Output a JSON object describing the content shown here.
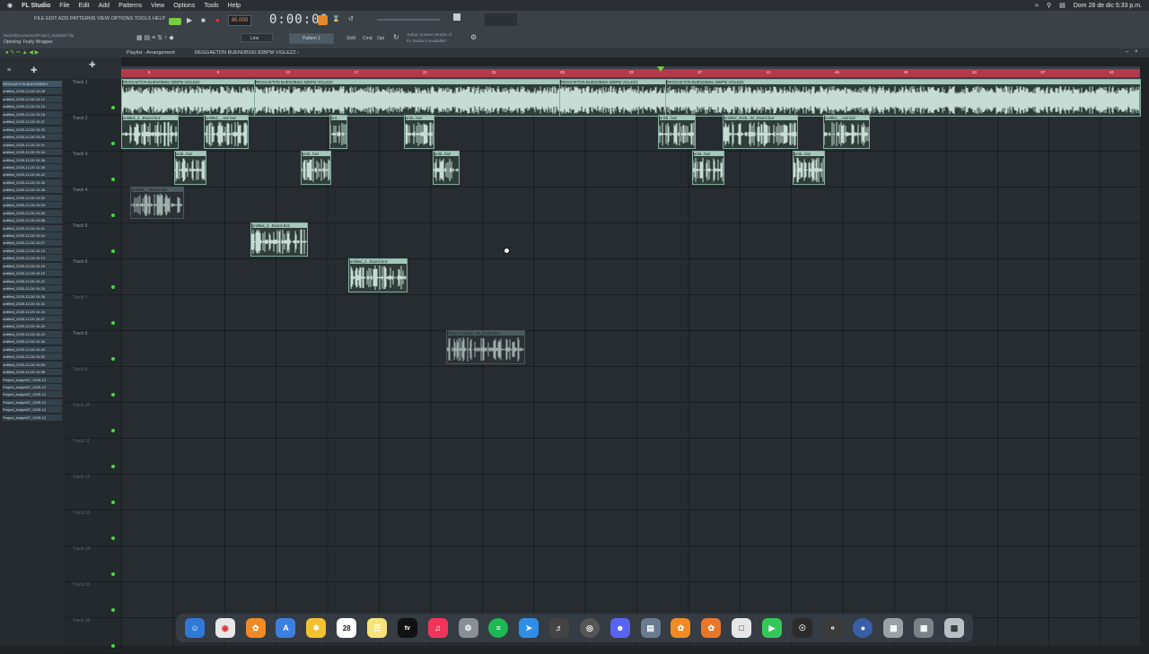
{
  "menubar": {
    "app": "FL Studio",
    "items": [
      "File",
      "Edit",
      "Add",
      "Patterns",
      "View",
      "Options",
      "Tools",
      "Help"
    ],
    "clock": "Dom 28 de dic 5:33 p.m."
  },
  "toolbar": {
    "menu_text": "FILE EDIT ADD PATTERNS VIEW OPTIONS TOOLS HELP",
    "tempo": "85.000",
    "time": "0:00:00",
    "project_path": "Music/Documents/Project_bulaph07.flp",
    "status": "Opening: Fruity Wrapper",
    "snap": "Line",
    "pattern": "Pattern 1",
    "mode_shift": "Shift",
    "mode_cmd": "Cmd",
    "mode_opt": "Opt",
    "news_line1": "Today: Answer version of",
    "news_line2": "FL Studio is available!"
  },
  "playlist": {
    "title": "Playlist - Arrangement",
    "breadcrumb": "REGGAETON BUENOBSKI 82BPM VIGLEZ2 ›",
    "ruler_ticks": [
      "5",
      "9",
      "13",
      "17",
      "21",
      "25",
      "29",
      "33",
      "37",
      "41",
      "45",
      "49",
      "53",
      "57",
      "61"
    ]
  },
  "browser": {
    "items": [
      "REGGAETON BUENOBSKI",
      "untitled_2025-12-26 15-08",
      "untitled_2025-12-26 15-12",
      "untitled_2025-12-26 15-15",
      "untitled_2025-12-26 15-18",
      "untitled_2025-12-26 15-21",
      "untitled_2025-12-26 15-25",
      "untitled_2025-12-26 15-28",
      "untitled_2025-12-26 15-31",
      "untitled_2025-12-26 15-34",
      "untitled_2025-12-26 15-36",
      "untitled_2025-12-26 15-39",
      "untitled_2025-12-26 15-42",
      "untitled_2025-12-26 15-45",
      "untitled_2025-12-26 15-48",
      "untitled_2025-12-26 15-50",
      "untitled_2025-12-26 15-53",
      "untitled_2025-12-26 15-55",
      "untitled_2025-12-26 15-58",
      "untitled_2025-12-26 16-01",
      "untitled_2025-12-26 16-04",
      "untitled_2025-12-26 16-07",
      "untitled_2025-12-26 16-10",
      "untitled_2025-12-26 16-13",
      "untitled_2025-12-26 16-16",
      "untitled_2025-12-26 16-19",
      "untitled_2025-12-26 16-22",
      "untitled_2025-12-26 16-25",
      "untitled_2025-12-26 16-28",
      "untitled_2025-12-26 16-31",
      "untitled_2025-12-26 16-34",
      "untitled_2025-12-26 16-37",
      "untitled_2025-12-26 16-40",
      "untitled_2025-12-26 16-43",
      "untitled_2025-12-26 16-46",
      "untitled_2025-12-26 16-49",
      "untitled_2025-12-26 16-52",
      "untitled_2025-12-26 16-55",
      "untitled_2025-12-26 16-58",
      "Project_bulaph07_2025-12",
      "Project_bulaph07_2025-12",
      "Project_bulaph07_2025-12",
      "Project_bulaph07_2025-12",
      "Project_bulaph07_2025-12",
      "Project_bulaph07_2025-12"
    ]
  },
  "tracks": [
    "Track 1",
    "Track 2",
    "Track 3",
    "Track 4",
    "Track 5",
    "Track 6",
    "Track 7",
    "Track 8",
    "Track 9",
    "Track 10",
    "Track 11",
    "Track 12",
    "Track 13",
    "Track 14",
    "Track 15",
    "Track 16"
  ],
  "clips": {
    "track1": [
      "REGGAETON BUENOBSKI 82BPM VIGLEZ2",
      "REGGAETON BUENOBSKI 82BPM VIGLEZ2",
      "REGGAETON BUENOBSKI 82BPM VIGLEZ2",
      "REGGAETON BUENOBSKI 82BPM VIGLEZ2"
    ],
    "track2": [
      "untitled_2...Doomi boz",
      "untitled_...ami boz",
      "unt...",
      "untit...boz",
      "untitl...boz",
      "untitled_2025...02_Doomi boz",
      "untitled_...omi boz"
    ],
    "track3": [
      "untit...boz",
      "untit...boz",
      "untit...boz",
      "untit...boz",
      "untit...boz"
    ],
    "track4": [
      "untitled_...Doomi boz"
    ],
    "track5": [
      "untitled_2...Doomi boz"
    ],
    "track6": [
      "untitled_2...Doomi boz"
    ],
    "track8": [
      "Project_bulaph...54_Doomi boz"
    ]
  },
  "dock": {
    "calendar_day": "28",
    "tv_label": "tv"
  }
}
